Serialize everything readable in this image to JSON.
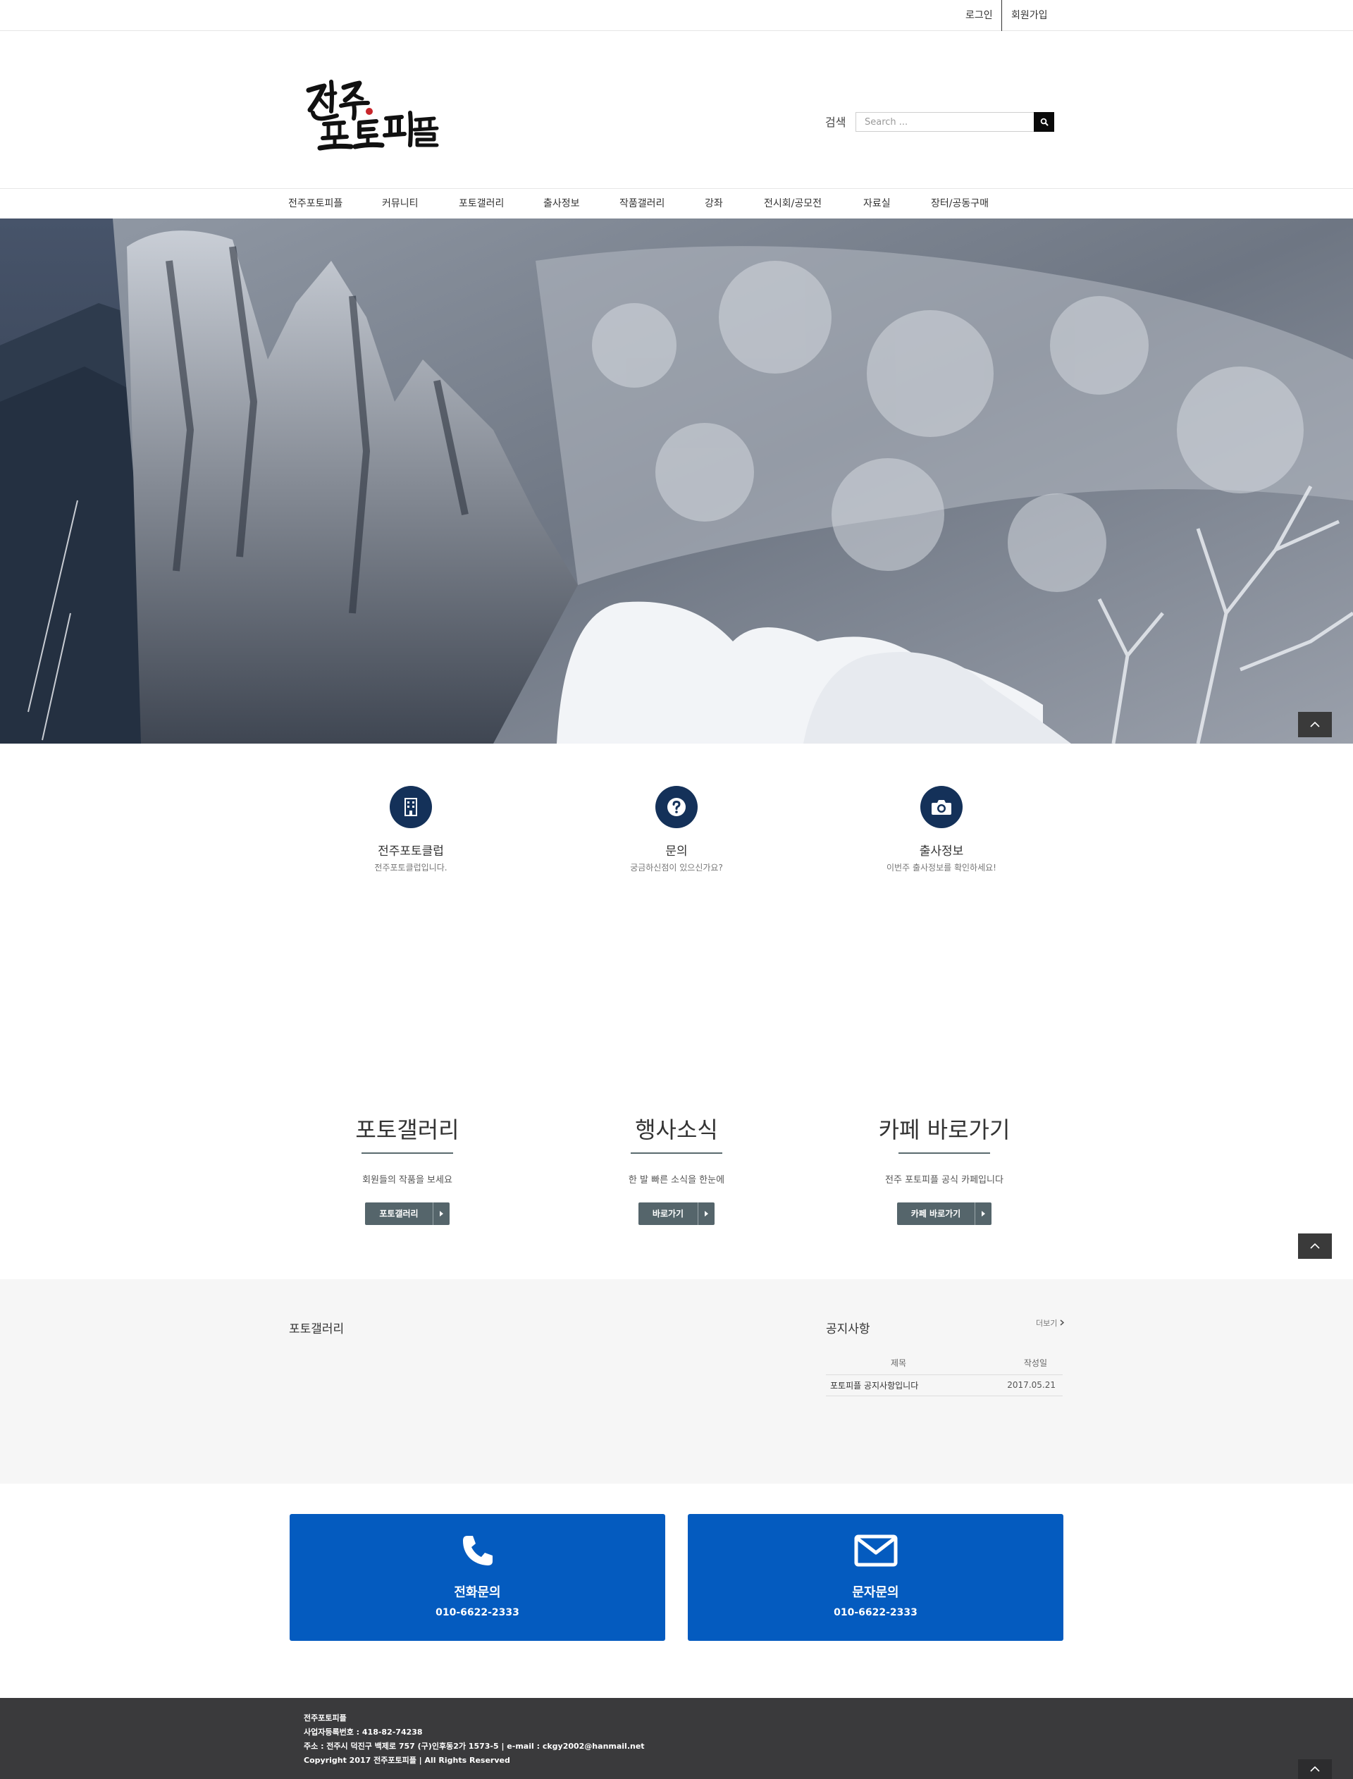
{
  "topbar": {
    "login": "로그인",
    "signup": "회원가입"
  },
  "header": {
    "logo_text": "전주 포토피플",
    "search_label": "검색",
    "search_placeholder": "Search ..."
  },
  "nav": [
    "전주포토피플",
    "커뮤니티",
    "포토갤러리",
    "출사정보",
    "작품갤러리",
    "강좌",
    "전시회/공모전",
    "자료실",
    "장터/공동구매"
  ],
  "features": [
    {
      "title": "전주포토클럽",
      "subtitle": "전주포토클럽입니다.",
      "icon": "building-icon"
    },
    {
      "title": "문의",
      "subtitle": "궁금하신점이 있으신가요?",
      "icon": "question-icon"
    },
    {
      "title": "출사정보",
      "subtitle": "이번주 출사정보를 확인하세요!",
      "icon": "camera-icon"
    }
  ],
  "promos": [
    {
      "title": "포토갤러리",
      "subtitle": "회원들의 작품을 보세요",
      "button": "포토갤러리"
    },
    {
      "title": "행사소식",
      "subtitle": "한 발 빠른 소식을 한눈에",
      "button": "바로가기"
    },
    {
      "title": "카페 바로가기",
      "subtitle": "전주 포토피플 공식 카페입니다",
      "button": "카페 바로가기"
    }
  ],
  "gallery_section": {
    "title": "포토갤러리"
  },
  "notice_section": {
    "title": "공지사항",
    "more": "더보기",
    "columns": [
      "제목",
      "작성일"
    ],
    "rows": [
      {
        "title": "포토피플 공지사항입니다",
        "date": "2017.05.21"
      }
    ]
  },
  "contacts": [
    {
      "title": "전화문의",
      "number": "010-6622-2333",
      "icon": "phone-icon"
    },
    {
      "title": "문자문의",
      "number": "010-6622-2333",
      "icon": "envelope-icon"
    }
  ],
  "footer": {
    "name": "전주포토피플",
    "business_no": "사업자등록번호 : 418-82-74238",
    "address": "주소 : 전주시 덕진구 백제로 757 (구)인후동2가 1573-5 | e-mail : ckgy2002@hanmail.net",
    "copyright": "Copyright 2017 전주포토피플 | All Rights Reserved"
  },
  "colors": {
    "navy": "#143159",
    "promo_button": "#55656b",
    "contact_blue": "#045bbf",
    "footer_bg": "#3a3a3c",
    "gray_section": "#f6f6f6"
  }
}
